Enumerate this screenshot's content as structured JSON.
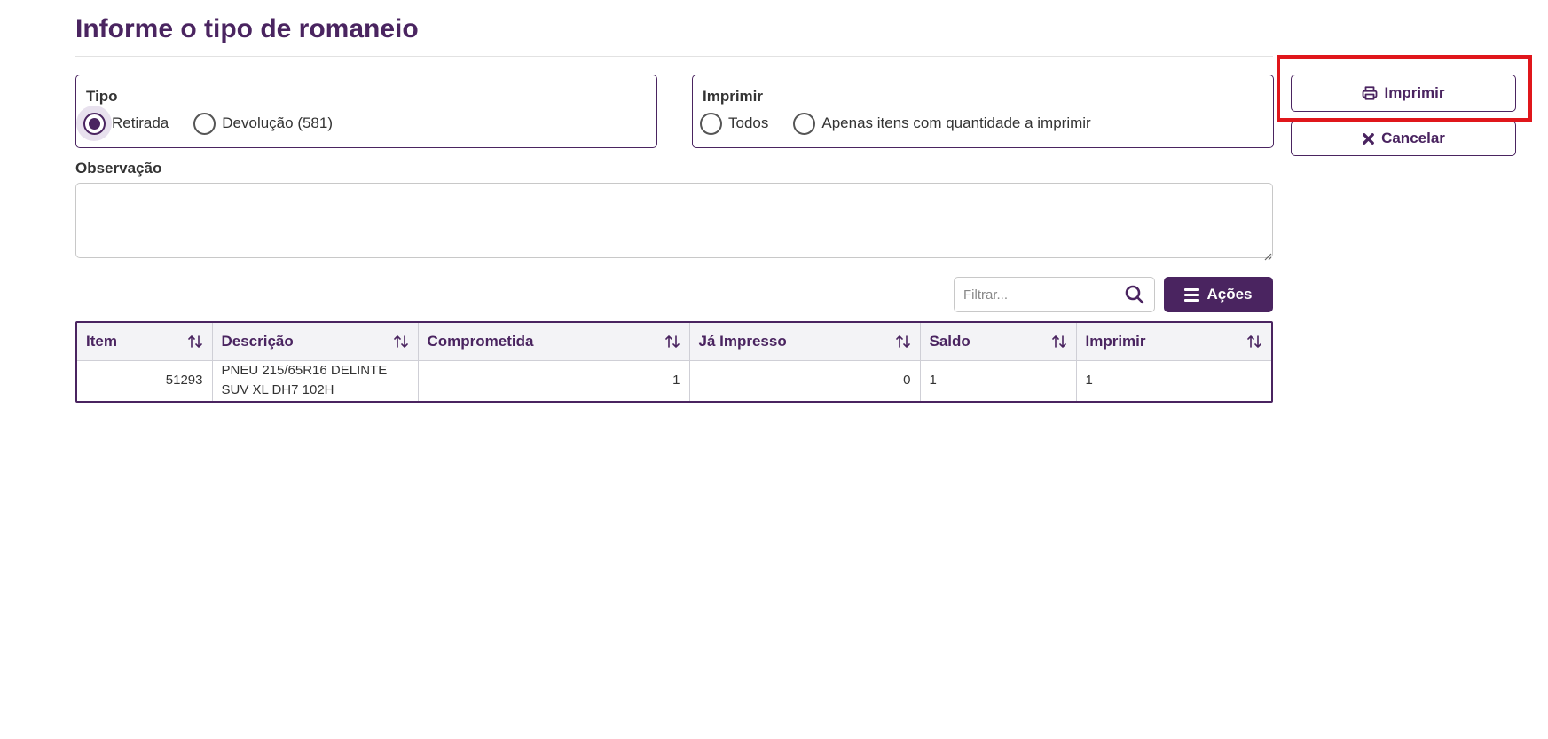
{
  "page": {
    "title": "Informe o tipo de romaneio"
  },
  "tipo": {
    "legend": "Tipo",
    "options": [
      {
        "label": "Retirada",
        "checked": true
      },
      {
        "label": "Devolução (581)",
        "checked": false
      }
    ]
  },
  "imprimir_group": {
    "legend": "Imprimir",
    "options": [
      {
        "label": "Todos",
        "checked": false
      },
      {
        "label": "Apenas itens com quantidade a imprimir",
        "checked": false
      }
    ]
  },
  "observacao": {
    "label": "Observação",
    "value": ""
  },
  "actions": {
    "print_label": "Imprimir",
    "cancel_label": "Cancelar"
  },
  "toolbar": {
    "filter_placeholder": "Filtrar...",
    "acoes_label": "Ações"
  },
  "table": {
    "columns": [
      "Item",
      "Descrição",
      "Comprometida",
      "Já Impresso",
      "Saldo",
      "Imprimir"
    ],
    "rows": [
      {
        "item": "51293",
        "descricao": "PNEU 215/65R16 DELINTE SUV XL DH7 102H",
        "comprometida": "1",
        "ja_impresso": "0",
        "saldo": "1",
        "imprimir": "1"
      }
    ]
  },
  "colors": {
    "accent": "#4a2460",
    "highlight": "#e0161b"
  }
}
